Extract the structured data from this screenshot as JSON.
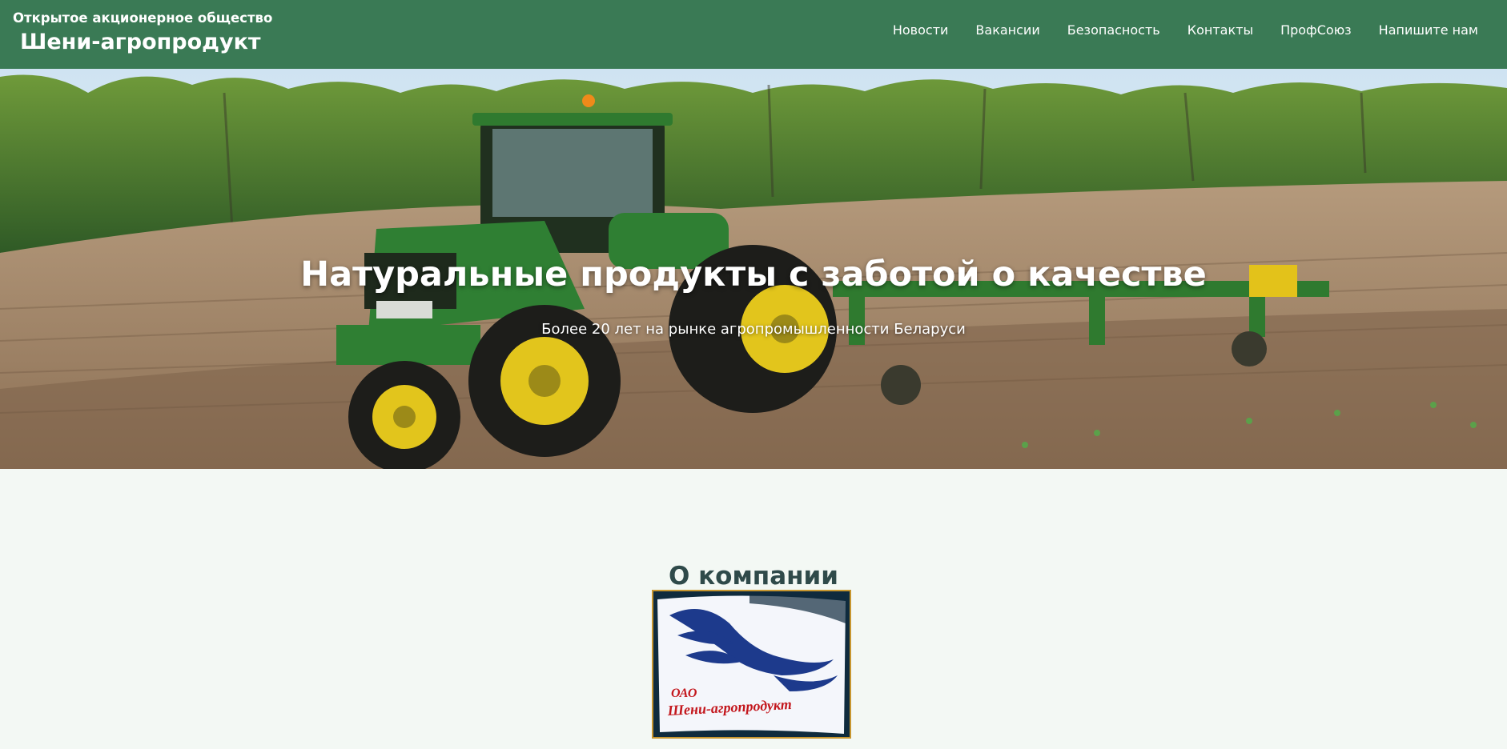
{
  "header": {
    "company_type": "Открытое акционерное общество",
    "company_name": "Шени-агропродукт"
  },
  "nav": {
    "items": [
      {
        "label": "Новости"
      },
      {
        "label": "Вакансии"
      },
      {
        "label": "Безопасность"
      },
      {
        "label": "Контакты"
      },
      {
        "label": "ПрофСоюз"
      },
      {
        "label": "Напишите нам"
      }
    ]
  },
  "hero": {
    "title": "Натуральные продукты с заботой о качестве",
    "subtitle": "Более 20 лет на рынке агропромышленности Беларуси"
  },
  "about": {
    "title": "О компании",
    "logo_text_line1": "ОАО",
    "logo_text_line2": "Шени-агропродукт"
  },
  "colors": {
    "header_bg": "#3a7a55",
    "page_bg": "#f3f8f4",
    "section_title": "#2f4a4a",
    "logo_border": "#c7962f"
  }
}
